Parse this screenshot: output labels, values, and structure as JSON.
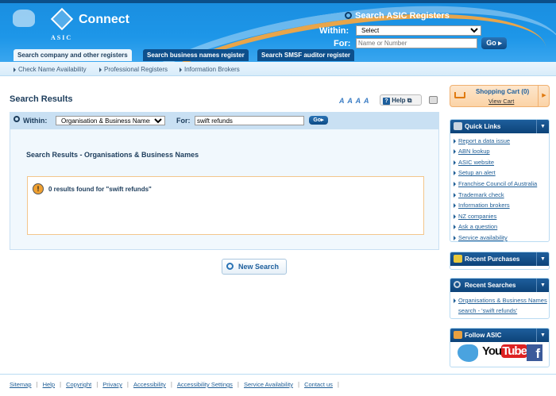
{
  "header": {
    "brand": "Connect",
    "org": "ASIC",
    "search_title": "Search ASIC Registers",
    "within_label": "Within:",
    "within_value": "Select",
    "for_label": "For:",
    "for_placeholder": "Name or Number",
    "go": "Go"
  },
  "tabs": [
    {
      "label": "Search company and other registers"
    },
    {
      "label": "Search business names register"
    },
    {
      "label": "Search SMSF auditor register"
    }
  ],
  "subnav": [
    {
      "label": "Check Name Availability"
    },
    {
      "label": "Professional Registers"
    },
    {
      "label": "Information Brokers"
    }
  ],
  "main": {
    "title": "Search Results",
    "font_sizes": "A A A A",
    "help": "Help",
    "search": {
      "within_label": "Within:",
      "within_value": "Organisation & Business Names",
      "for_label": "For:",
      "for_value": "swift refunds",
      "go": "Go"
    },
    "results_heading": "Search Results - Organisations & Business Names",
    "no_results": "0 results found for \"swift refunds\"",
    "new_search": "New Search"
  },
  "sidebar": {
    "cart_title": "Shopping Cart (0)",
    "view_cart": "View Cart",
    "quick_links_title": "Quick Links",
    "quick_links": [
      "Report a data issue",
      "ABN lookup",
      "ASIC website",
      "Setup an alert",
      "Franchise Council of Australia",
      "Trademark check",
      "Information brokers",
      "NZ companies",
      "Ask a question",
      "Service availability"
    ],
    "recent_purchases_title": "Recent Purchases",
    "recent_searches_title": "Recent Searches",
    "recent_search_line1": "Organisations & Business Names",
    "recent_search_line2": "search - 'swift refunds'",
    "follow_title": "Follow ASIC",
    "social": {
      "twitter": "Twitter",
      "youtube_you": "You",
      "youtube_tube": "Tube",
      "facebook": "f"
    }
  },
  "footer": [
    "Sitemap",
    "Help",
    "Copyright",
    "Privacy",
    "Accessibility",
    "Accessibility Settings",
    "Service Availability",
    "Contact us"
  ]
}
